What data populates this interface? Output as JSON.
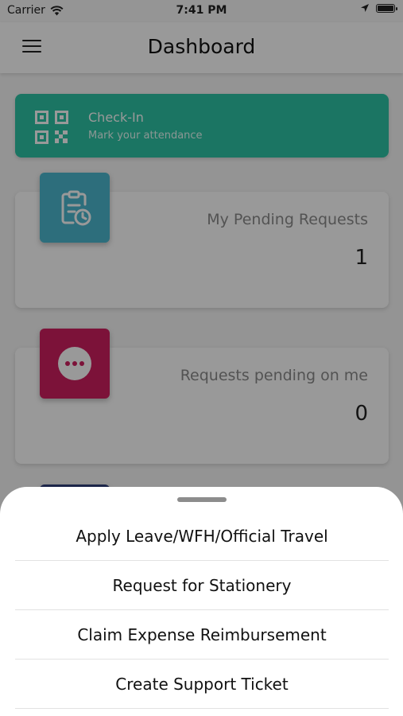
{
  "status_bar": {
    "carrier": "Carrier",
    "time": "7:41 PM"
  },
  "nav": {
    "title": "Dashboard",
    "menu_icon": "hamburger-menu-icon"
  },
  "checkin": {
    "title": "Check-In",
    "subtitle": "Mark your attendance",
    "icon": "qr-code-icon",
    "color": "#2ec4a5"
  },
  "cards": [
    {
      "title": "My Pending Requests",
      "count": "1",
      "icon": "clipboard-clock-icon",
      "color": "#4bb7cf"
    },
    {
      "title": "Requests pending on me",
      "count": "0",
      "icon": "more-dots-icon",
      "color": "#cf1f5f"
    }
  ],
  "sheet": {
    "items": [
      "Apply Leave/WFH/Official Travel",
      "Request for Stationery",
      "Claim Expense Reimbursement",
      "Create Support Ticket"
    ]
  }
}
